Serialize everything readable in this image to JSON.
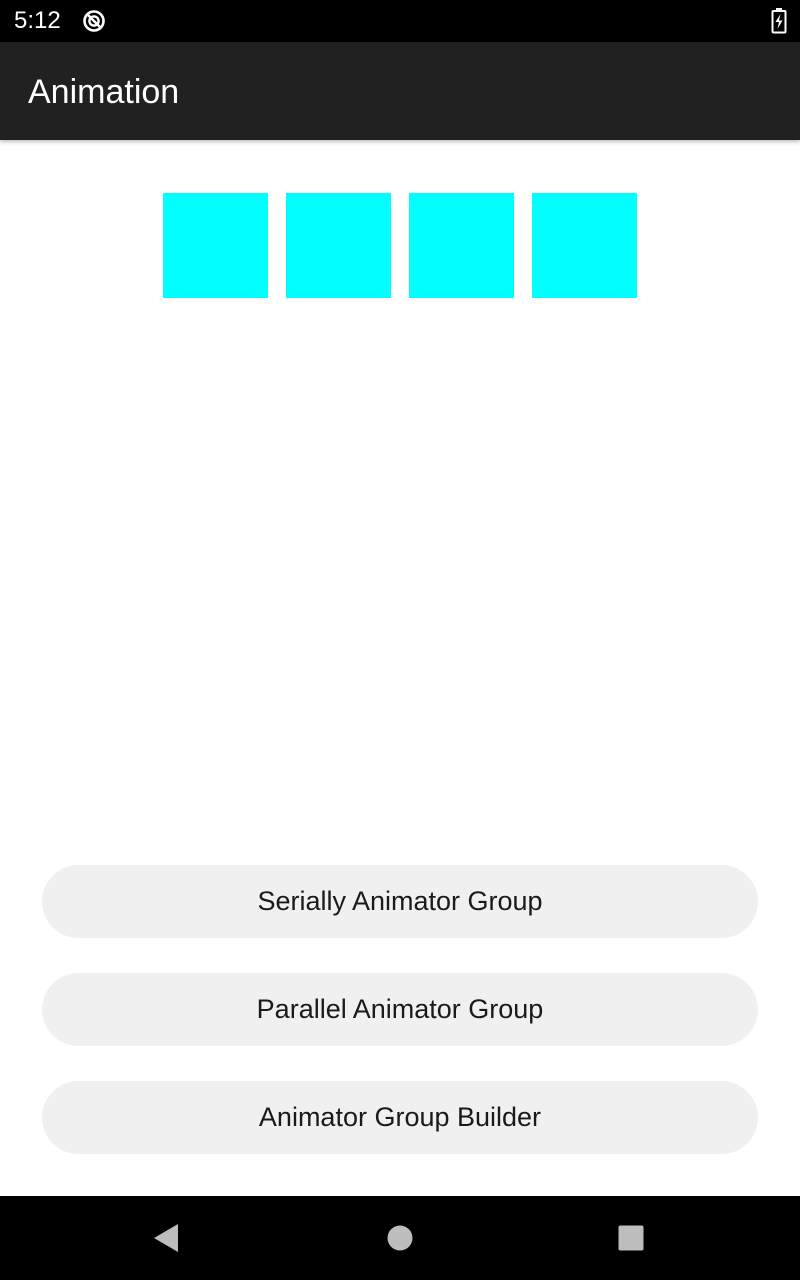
{
  "status_bar": {
    "time": "5:12",
    "icons": [
      "sync-icon",
      "battery-charging-icon"
    ]
  },
  "app_bar": {
    "title": "Animation"
  },
  "squares": {
    "count": 4,
    "color": "#00ffff"
  },
  "buttons": [
    {
      "label": "Serially Animator Group"
    },
    {
      "label": "Parallel Animator Group"
    },
    {
      "label": "Animator Group Builder"
    }
  ],
  "nav_bar": {
    "icons": [
      "back-icon",
      "home-icon",
      "recents-icon"
    ]
  },
  "colors": {
    "status_bar_bg": "#000000",
    "app_bar_bg": "#212121",
    "button_bg": "#f0f0f0",
    "square": "#00ffff",
    "nav_icon": "#bdbdbd"
  }
}
